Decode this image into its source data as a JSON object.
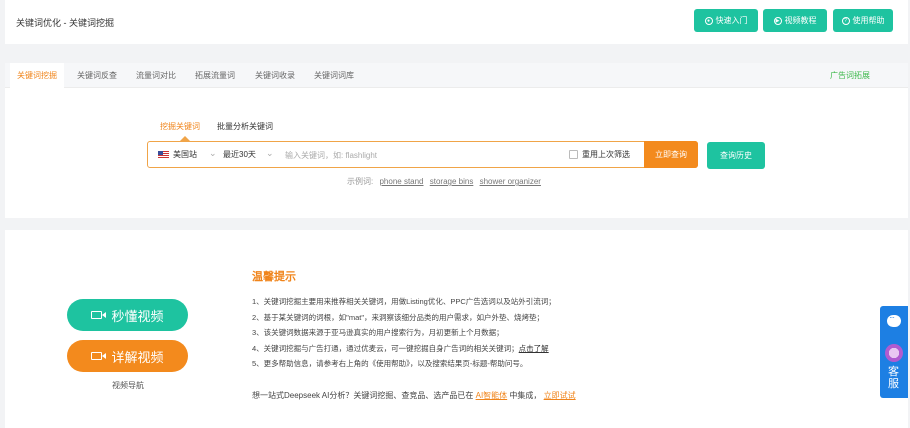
{
  "breadcrumb": "关键词优化 - 关键词挖掘",
  "top_buttons": [
    {
      "label": "快速入门"
    },
    {
      "label": "视频教程"
    },
    {
      "label": "使用帮助"
    }
  ],
  "tabs": [
    {
      "label": "关键词挖掘",
      "active": true
    },
    {
      "label": "关键词反查"
    },
    {
      "label": "流量词对比"
    },
    {
      "label": "拓展流量词"
    },
    {
      "label": "关键词收录"
    },
    {
      "label": "关键词词库"
    }
  ],
  "tab_right": "广告词拓展",
  "subtabs": [
    {
      "label": "挖掘关键词",
      "active": true
    },
    {
      "label": "批量分析关键词"
    }
  ],
  "search": {
    "site": "美国站",
    "period": "最近30天",
    "placeholder": "输入关键词，如: flashlight",
    "reuse_label": "重用上次筛选",
    "query_label": "立即查询",
    "history_label": "查询历史"
  },
  "examples": {
    "prefix": "示例词:",
    "items": [
      "phone stand",
      "storage bins",
      "shower organizer"
    ]
  },
  "video": {
    "quick_label": "秒懂视频",
    "detail_label": "详解视频",
    "nav_label": "视频导航"
  },
  "tips": {
    "title": "温馨提示",
    "items": [
      "1、关键词挖掘主要用来推荐相关关键词，用做Listing优化、PPC广告选词以及站外引流词；",
      "2、基于某关键词的词根，如\"mat\"，来洞察该细分品类的用户需求，如户外垫、烧烤垫；",
      "3、该关键词数据来源于亚马逊真实的用户搜索行为，月初更新上个月数据；",
      "4、关键词挖掘与广告打通，通过优麦云，可一键挖掘自身广告词的相关关键词；",
      "5、更多帮助信息，请参考右上角的《使用帮助》，以及搜索结果页-标题-帮助问号。"
    ],
    "item4_link": "点击了解"
  },
  "promo": {
    "text_before": "想一站式Deepseek AI分析？关键词挖掘、查竞品、选产品已在",
    "highlight": "AI智能体",
    "text_middle": "中集成，",
    "action": "立即试试"
  },
  "float": {
    "label": "客服"
  },
  "colors": {
    "teal": "#1ec3a0",
    "orange": "#f38a1d",
    "green_link": "#3cb84a",
    "float_blue": "#1d7fe3"
  }
}
